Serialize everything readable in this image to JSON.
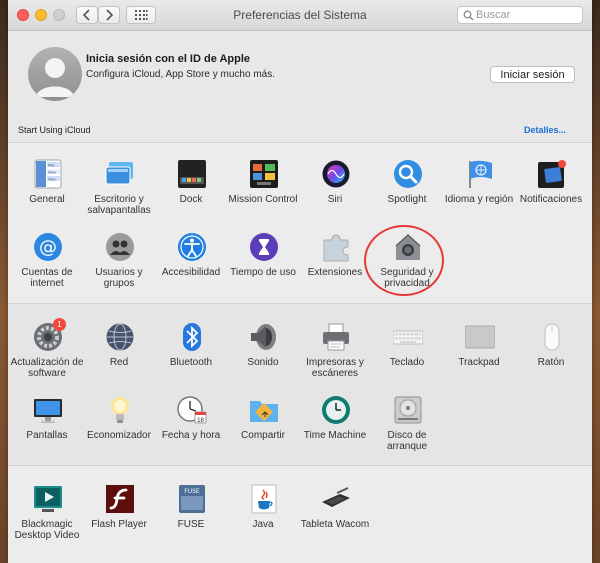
{
  "window": {
    "title": "Preferencias del Sistema"
  },
  "search": {
    "placeholder": "Buscar"
  },
  "account": {
    "title": "Inicia sesión con el ID de Apple",
    "subtitle": "Configura iCloud, App Store y mucho más.",
    "signin_label": "Iniciar sesión",
    "icloud_label": "Start Using iCloud",
    "details_label": "Detalles..."
  },
  "sections": {
    "personal": [
      {
        "label": "General",
        "icon": "general-icon"
      },
      {
        "label": "Escritorio y salvapantallas",
        "icon": "desktop-icon"
      },
      {
        "label": "Dock",
        "icon": "dock-icon"
      },
      {
        "label": "Mission Control",
        "icon": "mission-control-icon"
      },
      {
        "label": "Siri",
        "icon": "siri-icon"
      },
      {
        "label": "Spotlight",
        "icon": "spotlight-icon"
      },
      {
        "label": "Idioma y región",
        "icon": "flag-icon"
      },
      {
        "label": "Notificaciones",
        "icon": "notifications-icon"
      },
      {
        "label": "Cuentas de internet",
        "icon": "at-icon"
      },
      {
        "label": "Usuarios y grupos",
        "icon": "users-icon"
      },
      {
        "label": "Accesibilidad",
        "icon": "accessibility-icon"
      },
      {
        "label": "Tiempo de uso",
        "icon": "hourglass-icon"
      },
      {
        "label": "Extensiones",
        "icon": "puzzle-icon"
      },
      {
        "label": "Seguridad y privacidad",
        "icon": "house-lock-icon"
      }
    ],
    "hardware": [
      {
        "label": "Actualización de software",
        "icon": "gear-icon",
        "badge": "1"
      },
      {
        "label": "Red",
        "icon": "globe-icon"
      },
      {
        "label": "Bluetooth",
        "icon": "bluetooth-icon"
      },
      {
        "label": "Sonido",
        "icon": "speaker-icon"
      },
      {
        "label": "Impresoras y escáneres",
        "icon": "printer-icon"
      },
      {
        "label": "Teclado",
        "icon": "keyboard-icon"
      },
      {
        "label": "Trackpad",
        "icon": "trackpad-icon"
      },
      {
        "label": "Ratón",
        "icon": "mouse-icon"
      },
      {
        "label": "Pantallas",
        "icon": "display-icon"
      },
      {
        "label": "Economizador",
        "icon": "lightbulb-icon"
      },
      {
        "label": "Fecha y hora",
        "icon": "clock-icon",
        "date_day": "18"
      },
      {
        "label": "Compartir",
        "icon": "folder-share-icon"
      },
      {
        "label": "Time Machine",
        "icon": "time-machine-icon"
      },
      {
        "label": "Disco de arranque",
        "icon": "disk-icon"
      }
    ],
    "other": [
      {
        "label": "Blackmagic Desktop Video",
        "icon": "blackmagic-icon"
      },
      {
        "label": "Flash Player",
        "icon": "flash-icon"
      },
      {
        "label": "FUSE",
        "icon": "fuse-icon",
        "tag": "FUSE"
      },
      {
        "label": "Java",
        "icon": "java-icon"
      },
      {
        "label": "Tableta Wacom",
        "icon": "tablet-icon"
      }
    ]
  },
  "colors": {
    "accent": "#1e6fd6",
    "highlight_circle": "#e53935",
    "badge": "#f2483c"
  }
}
